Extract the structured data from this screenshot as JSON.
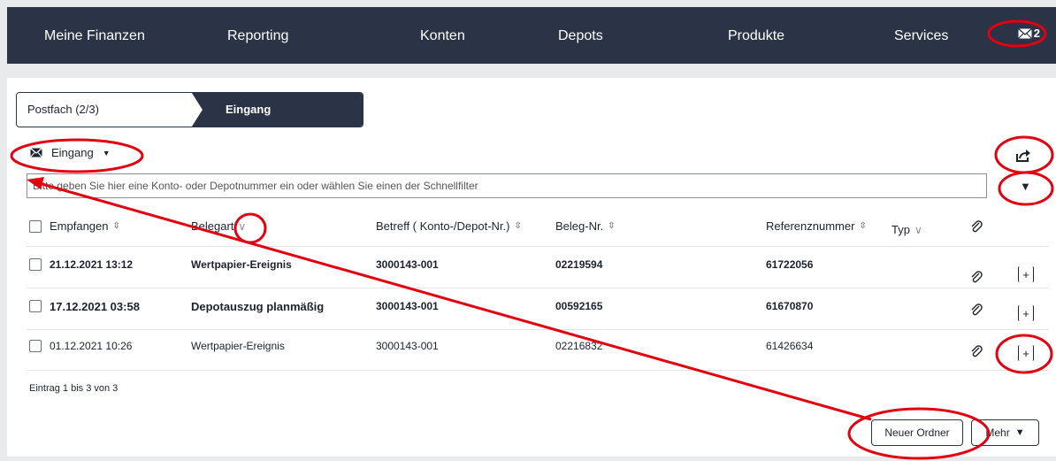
{
  "nav": {
    "items": [
      "Meine Finanzen",
      "Reporting",
      "Konten",
      "Depots",
      "Produkte",
      "Services"
    ],
    "mail_count": "2"
  },
  "breadcrumb": {
    "first": "Postfach (2/3)",
    "second": "Eingang"
  },
  "folder": {
    "label": "Eingang"
  },
  "filter": {
    "placeholder": "Bitte geben Sie hier eine Konto- oder Depotnummer ein oder wählen Sie einen der Schnellfilter"
  },
  "table": {
    "headers": {
      "received": "Empfangen",
      "type_doc": "Belegart",
      "subject": "Betreff ( Konto-/Depot-Nr.)",
      "doc_no": "Beleg-Nr.",
      "reference": "Referenznummer",
      "type": "Typ"
    },
    "rows": [
      {
        "received": "21.12.2021 13:12",
        "type_doc": "Wertpapier-Ereignis",
        "subject": "3000143-001",
        "doc_no": "02219594",
        "reference": "61722056",
        "unread": true
      },
      {
        "received": "17.12.2021 03:58",
        "type_doc": "Depotauszug planmäßig",
        "subject": "3000143-001",
        "doc_no": "00592165",
        "reference": "61670870",
        "unread": true
      },
      {
        "received": "01.12.2021 10:26",
        "type_doc": "Wertpapier-Ereignis",
        "subject": "3000143-001",
        "doc_no": "02216832",
        "reference": "61426634",
        "unread": false
      }
    ],
    "count_text": "Eintrag 1 bis 3 von 3"
  },
  "buttons": {
    "new_folder": "Neuer Ordner",
    "more": "Mehr"
  },
  "colors": {
    "nav_bg": "#2b3447",
    "annotation": "#e3000f"
  },
  "icons": {
    "mail": "envelope-icon",
    "share": "share-icon",
    "attachment": "paperclip-icon",
    "expand": "plus-icon"
  }
}
